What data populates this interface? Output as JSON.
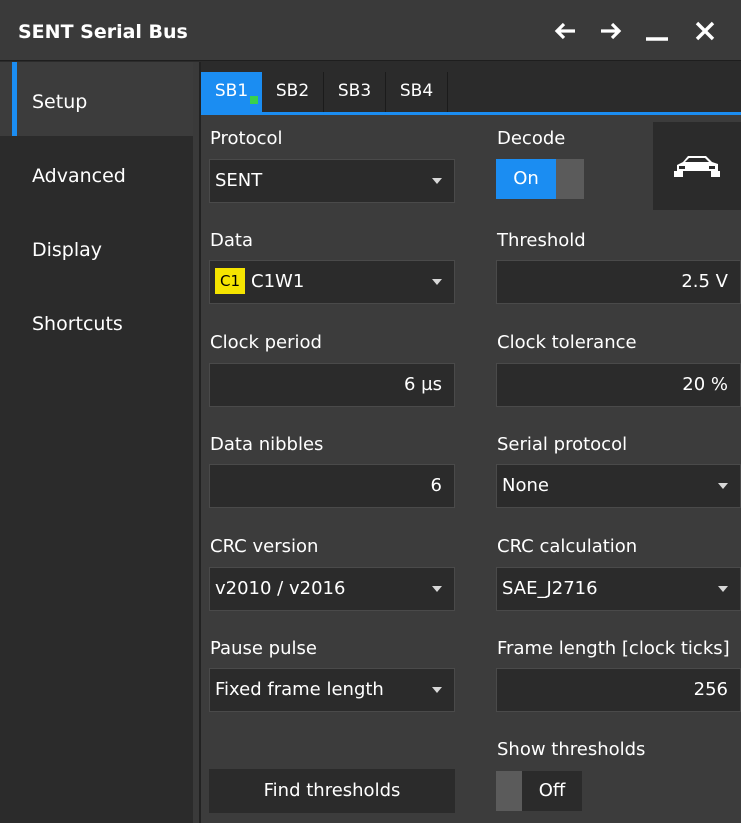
{
  "window": {
    "title": "SENT Serial Bus"
  },
  "sidebar": {
    "items": [
      {
        "label": "Setup"
      },
      {
        "label": "Advanced"
      },
      {
        "label": "Display"
      },
      {
        "label": "Shortcuts"
      }
    ]
  },
  "tabs": [
    {
      "label": "SB1"
    },
    {
      "label": "SB2"
    },
    {
      "label": "SB3"
    },
    {
      "label": "SB4"
    }
  ],
  "form": {
    "protocol": {
      "label": "Protocol",
      "value": "SENT"
    },
    "decode": {
      "label": "Decode",
      "state": "On"
    },
    "data": {
      "label": "Data",
      "badge": "C1",
      "value": "C1W1"
    },
    "threshold": {
      "label": "Threshold",
      "value": "2.5 V"
    },
    "clock_period": {
      "label": "Clock period",
      "value": "6 µs"
    },
    "clock_tolerance": {
      "label": "Clock tolerance",
      "value": "20 %"
    },
    "data_nibbles": {
      "label": "Data nibbles",
      "value": "6"
    },
    "serial_protocol": {
      "label": "Serial protocol",
      "value": "None"
    },
    "crc_version": {
      "label": "CRC version",
      "value": "v2010 / v2016"
    },
    "crc_calculation": {
      "label": "CRC calculation",
      "value": "SAE_J2716"
    },
    "pause_pulse": {
      "label": "Pause pulse",
      "value": "Fixed frame length"
    },
    "frame_length": {
      "label": "Frame length [clock ticks]",
      "value": "256"
    },
    "show_thresholds": {
      "label": "Show thresholds",
      "state": "Off"
    },
    "find_thresholds": {
      "label": "Find thresholds"
    }
  },
  "icons": {
    "back": "arrow-left-icon",
    "forward": "arrow-right-icon",
    "minimize": "minimize-icon",
    "close": "close-icon",
    "car": "car-icon"
  },
  "colors": {
    "accent": "#1b8df2",
    "channel_badge": "#f5e400",
    "status_dot": "#39d14c"
  }
}
